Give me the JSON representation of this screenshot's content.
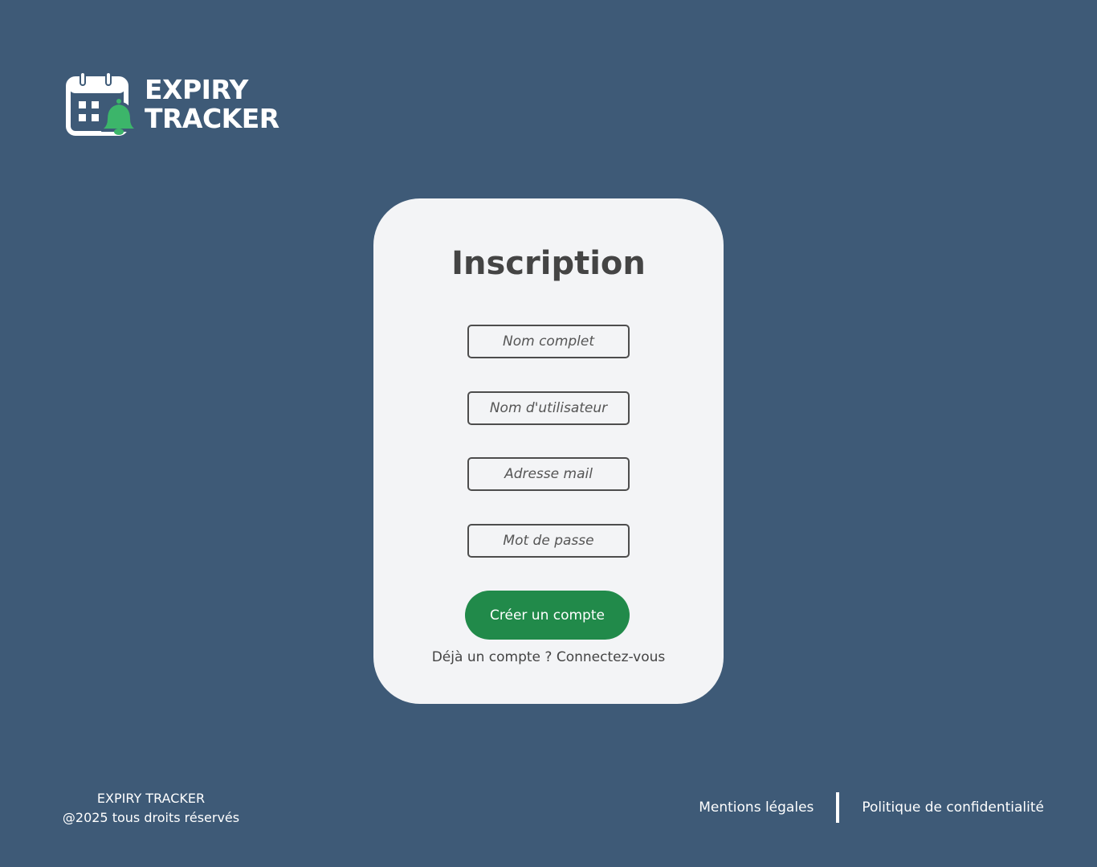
{
  "brand": {
    "line1": "EXPIRY",
    "line2": "TRACKER"
  },
  "form": {
    "title": "Inscription",
    "fields": {
      "full_name_placeholder": "Nom complet",
      "username_placeholder": "Nom d'utilisateur",
      "email_placeholder": "Adresse mail",
      "password_placeholder": "Mot de passe"
    },
    "submit_label": "Créer un compte",
    "login_prompt": "Déjà un compte ? ",
    "login_link": "Connectez-vous"
  },
  "footer": {
    "brand": "EXPIRY TRACKER",
    "copyright": "@2025 tous droits réservés",
    "legal_link": "Mentions légales",
    "privacy_link": "Politique de confidentialité"
  },
  "colors": {
    "background": "#3e5a77",
    "card": "#f3f4f6",
    "accent_green": "#218a4a",
    "bell_green": "#3cb56a",
    "text_dark": "#444444"
  },
  "icons": {
    "logo": "calendar-bell-icon"
  }
}
